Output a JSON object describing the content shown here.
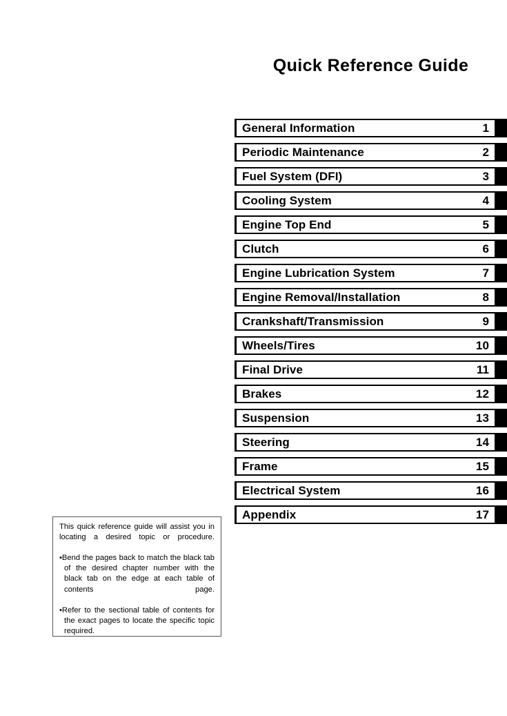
{
  "document": {
    "title": "Quick Reference Guide"
  },
  "chapters": [
    {
      "name": "General Information",
      "number": "1"
    },
    {
      "name": "Periodic Maintenance",
      "number": "2"
    },
    {
      "name": "Fuel System (DFI)",
      "number": "3"
    },
    {
      "name": "Cooling System",
      "number": "4"
    },
    {
      "name": "Engine Top End",
      "number": "5"
    },
    {
      "name": "Clutch",
      "number": "6"
    },
    {
      "name": "Engine Lubrication System",
      "number": "7"
    },
    {
      "name": "Engine Removal/Installation",
      "number": "8"
    },
    {
      "name": "Crankshaft/Transmission",
      "number": "9"
    },
    {
      "name": "Wheels/Tires",
      "number": "10"
    },
    {
      "name": "Final Drive",
      "number": "11"
    },
    {
      "name": "Brakes",
      "number": "12"
    },
    {
      "name": "Suspension",
      "number": "13"
    },
    {
      "name": "Steering",
      "number": "14"
    },
    {
      "name": "Frame",
      "number": "15"
    },
    {
      "name": "Electrical System",
      "number": "16"
    },
    {
      "name": "Appendix",
      "number": "17"
    }
  ],
  "note": {
    "intro": "This quick reference guide will assist you in locating a desired topic or procedure.",
    "bullets": [
      "Bend the pages back to match the black tab of the desired chapter number with the black tab on the edge at each table of contents page.",
      "Refer to the sectional table of contents for the exact pages to locate the specific topic required."
    ],
    "bullet_glyph": "•"
  },
  "colors": {
    "page_background": "#ffffff",
    "ink": "#000000",
    "tab_black": "#000000",
    "note_border": "#555555"
  }
}
